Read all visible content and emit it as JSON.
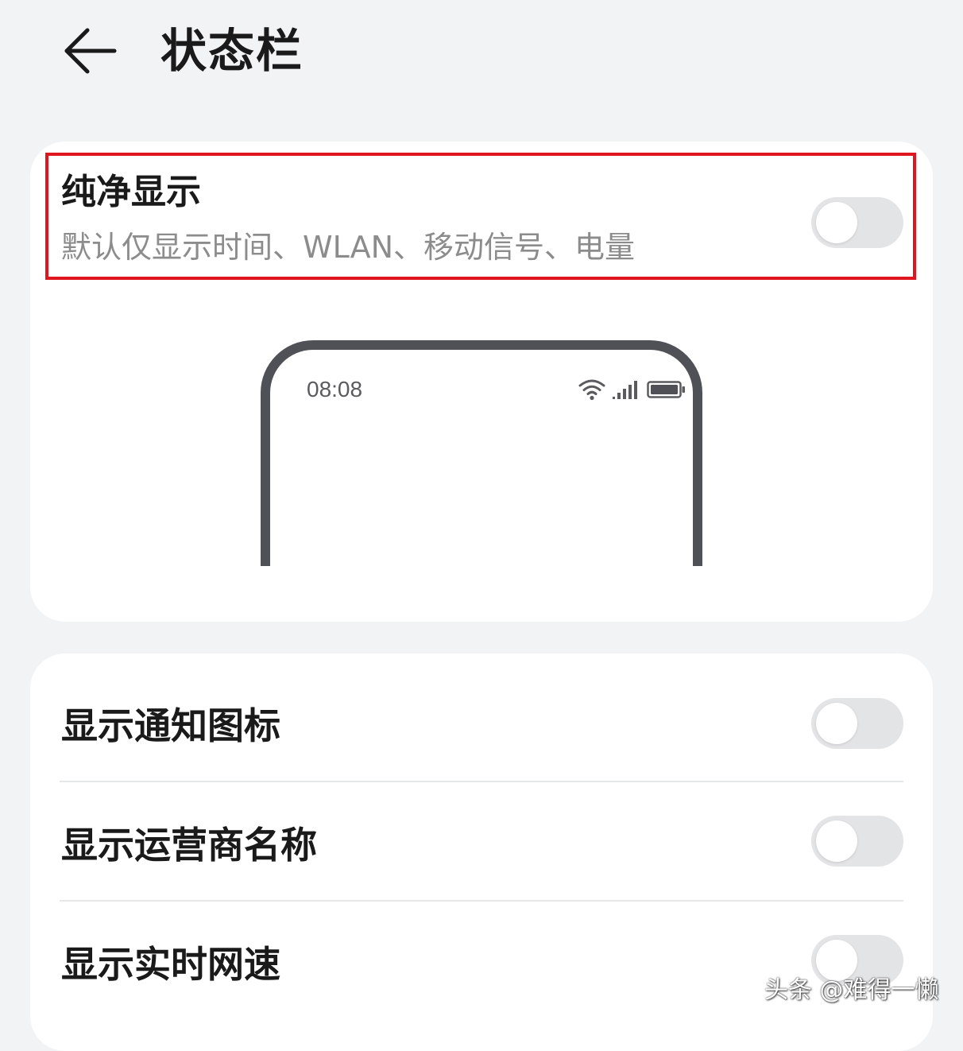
{
  "header": {
    "title": "状态栏",
    "back_icon": "arrow-left-icon"
  },
  "clean_display": {
    "title": "纯净显示",
    "subtitle": "默认仅显示时间、WLAN、移动信号、电量",
    "toggle_on": false
  },
  "preview": {
    "time": "08:08",
    "icons": [
      "wifi-icon",
      "signal-icon",
      "battery-icon"
    ]
  },
  "settings": [
    {
      "label": "显示通知图标",
      "toggle_on": false
    },
    {
      "label": "显示运营商名称",
      "toggle_on": false
    },
    {
      "label": "显示实时网速",
      "toggle_on": false
    }
  ],
  "watermark": "头条 @难得一懒",
  "colors": {
    "background": "#f1f3f5",
    "card": "#ffffff",
    "highlight_border": "#e0161e",
    "toggle_off": "#e3e4e6",
    "phone_frame": "#4f5157"
  }
}
